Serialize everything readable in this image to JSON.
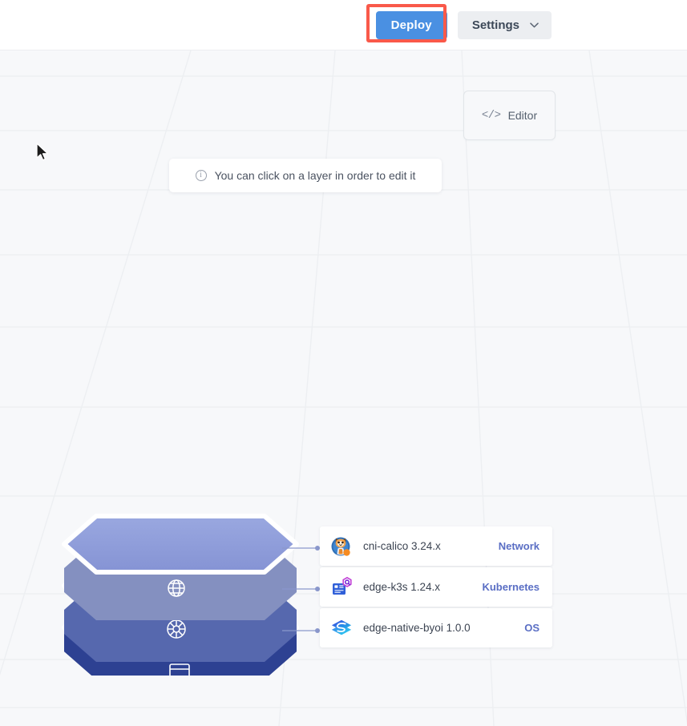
{
  "topbar": {
    "deploy_label": "Deploy",
    "settings_label": "Settings",
    "deploy_color": "#4a90e2",
    "highlight_color": "#f9594a",
    "settings_bg": "#eceef1",
    "chevron_icon": "chevron-down-icon"
  },
  "editor": {
    "label": "Editor",
    "code_icon": "</>",
    "icon_name": "code-brackets-icon"
  },
  "hint": {
    "icon": "info-circle-icon",
    "text": "You can click on a layer in order to edit it"
  },
  "stack": {
    "layers": [
      {
        "icon_name": "globe-icon",
        "top_color": "#8e9ddb",
        "side_color": "#8a96c4",
        "label": "Network"
      },
      {
        "icon_name": "helm-wheel-icon",
        "top_color": "#6f82c9",
        "side_color": "#5c6fb4",
        "label": "Kubernetes"
      },
      {
        "icon_name": "window-icon",
        "top_color": "#3e53a6",
        "side_color": "#2e4192",
        "label": "OS"
      }
    ]
  },
  "cards": [
    {
      "name": "cni-calico 3.24.x",
      "type": "Network",
      "icon_name": "calico-cat-icon",
      "type_color": "#5a6ec4"
    },
    {
      "name": "edge-k3s 1.24.x",
      "type": "Kubernetes",
      "icon_name": "k3s-icon",
      "type_color": "#4a5fc0"
    },
    {
      "name": "edge-native-byoi 1.0.0",
      "type": "OS",
      "icon_name": "spectro-layers-icon",
      "type_color": "#3e53a6"
    }
  ],
  "cursor": {
    "icon_name": "mouse-pointer-icon"
  },
  "canvas": {
    "background_color": "#f7f8fa",
    "grid_color": "#eef0f3"
  }
}
